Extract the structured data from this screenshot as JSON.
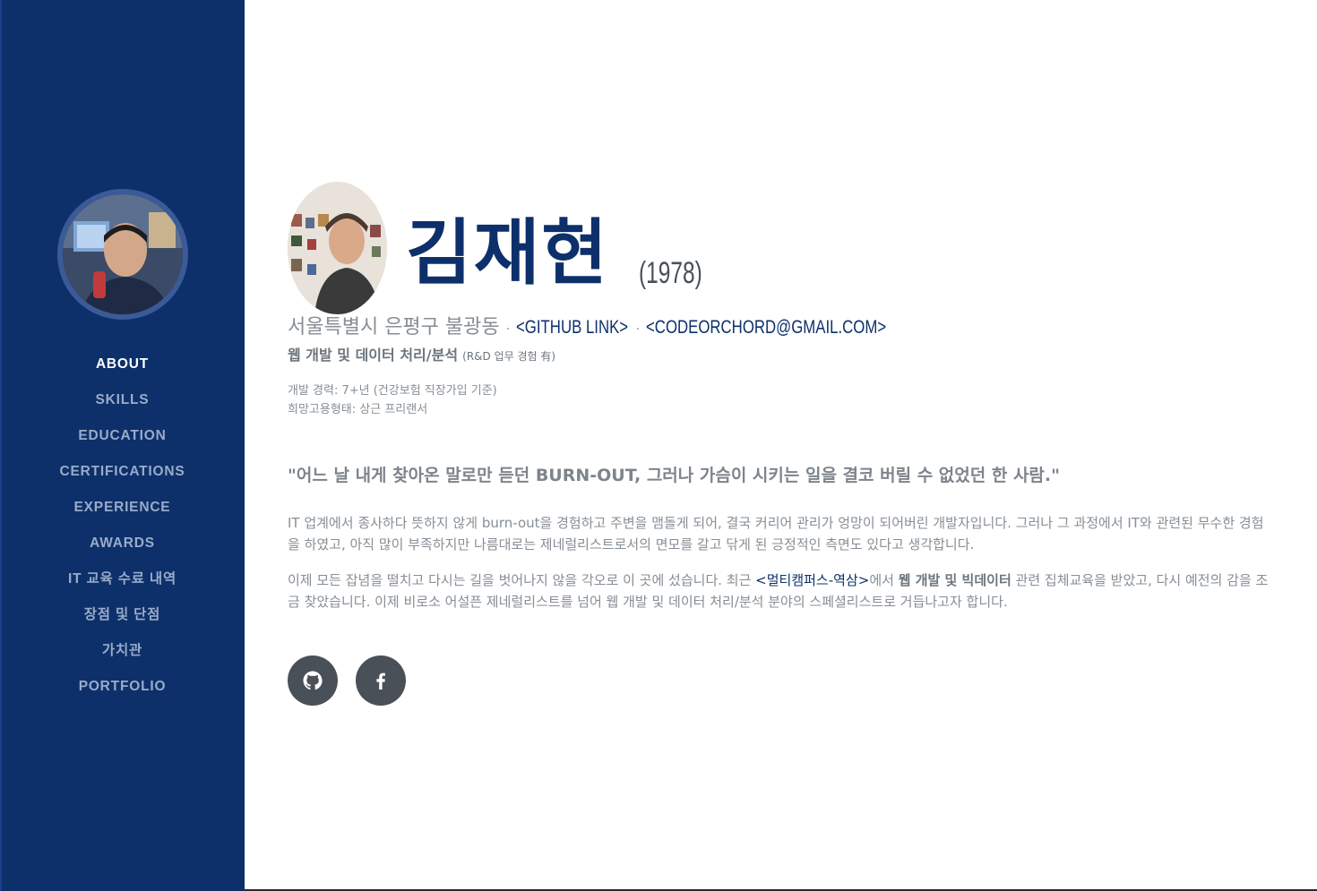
{
  "sidebar": {
    "avatar_alt": "profile photo",
    "items": [
      {
        "label": "ABOUT",
        "active": true
      },
      {
        "label": "SKILLS",
        "active": false
      },
      {
        "label": "EDUCATION",
        "active": false
      },
      {
        "label": "CERTIFICATIONS",
        "active": false
      },
      {
        "label": "EXPERIENCE",
        "active": false
      },
      {
        "label": "AWARDS",
        "active": false
      },
      {
        "label": "IT 교육 수료 내역",
        "active": false
      },
      {
        "label": "장점 및 단점",
        "active": false
      },
      {
        "label": "가치관",
        "active": false
      },
      {
        "label": "PORTFOLIO",
        "active": false
      }
    ]
  },
  "about": {
    "name": "김재현",
    "birth_year": "(1978)",
    "address": "서울특별시 은평구 불광동",
    "separator": "·",
    "github_link": "<GITHUB LINK>",
    "email_link": "<CODEORCHORD@GMAIL.COM>",
    "job_title": "웹 개발 및 데이터 처리/분석",
    "job_note": "(R&D 업무 경험 有)",
    "career": "개발 경력: 7+년 (건강보험 직장가입 기준)",
    "employment": "희망고용형태: 상근 프리랜서",
    "quote": "\"어느 날 내게 찾아온 말로만 듣던 BURN-OUT, 그러나 가슴이 시키는 일을 결코 버릴 수 없었던 한 사람.\"",
    "para1": "IT 업계에서 종사하다 뜻하지 않게 burn-out을 경험하고 주변을 맴돌게 되어, 결국 커리어 관리가 엉망이 되어버린 개발자입니다. 그러나 그 과정에서 IT와 관련된 무수한 경험을 하였고, 아직 많이 부족하지만 나름대로는 제네럴리스트로서의 면모를 갈고 닦게 된 긍정적인 측면도 있다고 생각합니다.",
    "para2_a": "이제 모든 잡념을 떨치고 다시는 길을 벗어나지 않을 각오로 이 곳에 섰습니다. 최근 ",
    "para2_link": "<멀티캠퍼스-역삼>",
    "para2_b": "에서 ",
    "para2_bold": "웹 개발 및 빅데이터",
    "para2_c": " 관련 집체교육을 받았고, 다시 예전의 감을 조금 찾았습니다. 이제 비로소 어설픈 제네럴리스트를 넘어 웹 개발 및 데이터 처리/분석 분야의 스페셜리스트로 거듭나고자 합니다."
  },
  "social": {
    "github_icon": "github-icon",
    "facebook_icon": "facebook-icon"
  },
  "colors": {
    "sidebar_bg": "#0d306b",
    "accent": "#0d306b",
    "nav_inactive": "#9aabc9",
    "nav_active": "#ffffff",
    "social_btn_bg": "#495057"
  }
}
